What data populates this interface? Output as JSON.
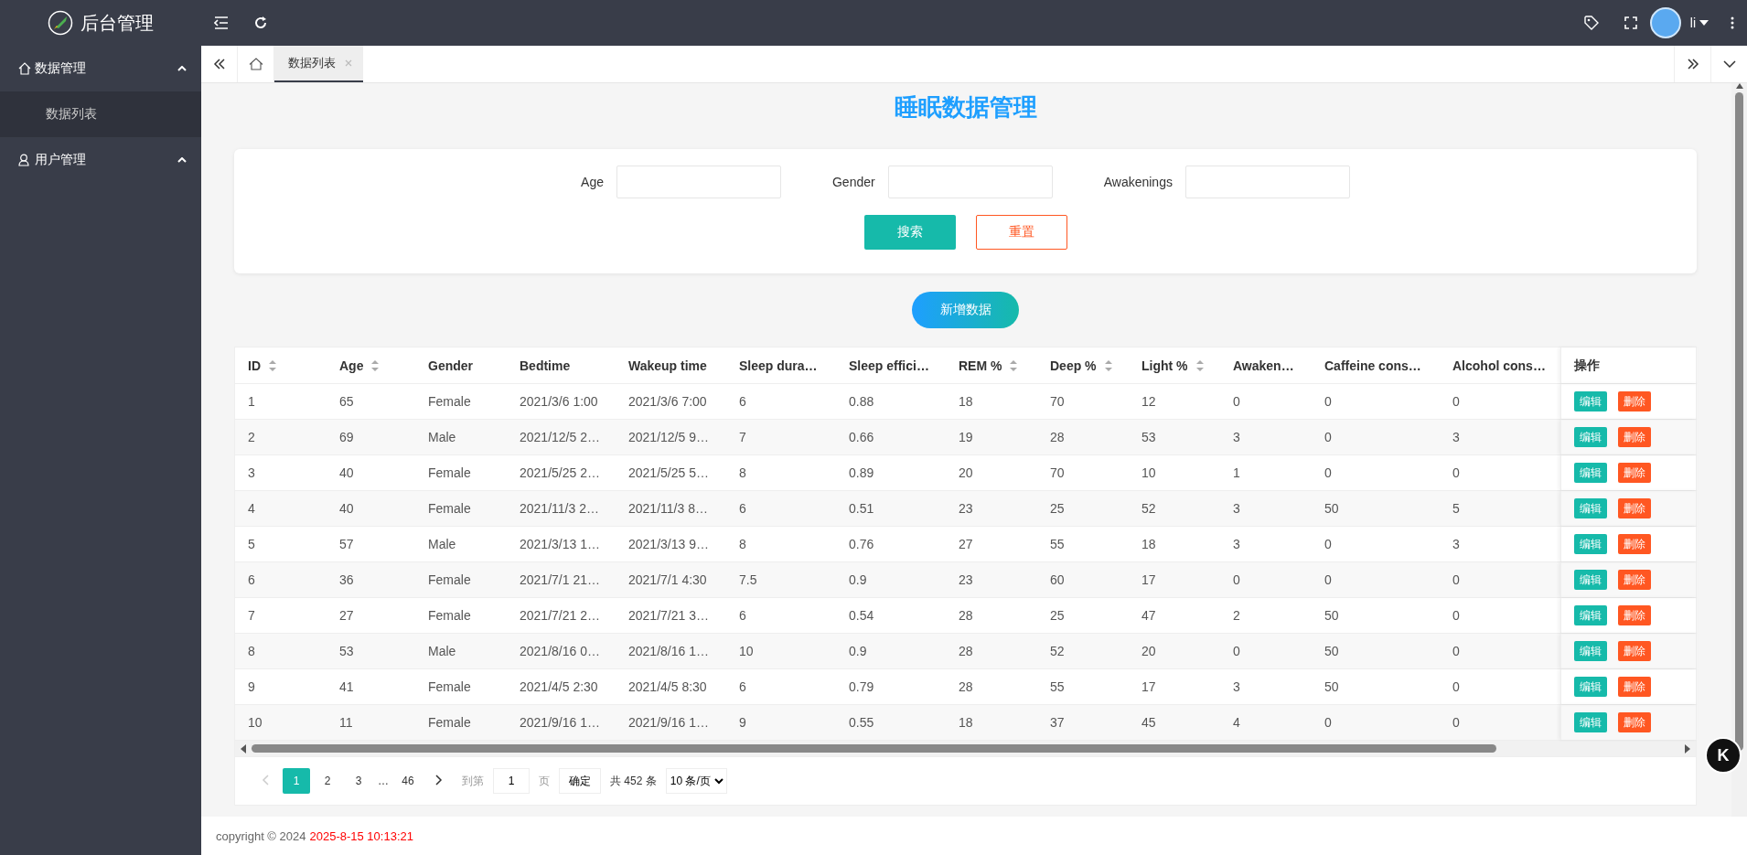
{
  "app": {
    "title": "后台管理"
  },
  "header": {
    "user": "li"
  },
  "sidebar": {
    "groups": [
      {
        "label": "数据管理",
        "kind": "data",
        "expanded": true,
        "children": [
          {
            "label": "数据列表",
            "selected": true
          }
        ]
      },
      {
        "label": "用户管理",
        "kind": "user",
        "expanded": true
      }
    ]
  },
  "tabs": [
    {
      "label": "数据列表",
      "selected": true
    }
  ],
  "page_title": "睡眠数据管理",
  "search": {
    "fields": [
      {
        "label": "Age"
      },
      {
        "label": "Gender"
      },
      {
        "label": "Awakenings"
      }
    ],
    "buttons": [
      {
        "label": "搜索",
        "kind": "primary"
      },
      {
        "label": "重置",
        "kind": "outline"
      }
    ]
  },
  "add_button": "新增数据",
  "table": {
    "columns": [
      {
        "label": "ID",
        "sortable": true
      },
      {
        "label": "Age",
        "sortable": true
      },
      {
        "label": "Gender",
        "sortable": false
      },
      {
        "label": "Bedtime",
        "sortable": false
      },
      {
        "label": "Wakeup time",
        "sortable": false
      },
      {
        "label": "Sleep dura…",
        "sortable": false
      },
      {
        "label": "Sleep effici…",
        "sortable": false
      },
      {
        "label": "REM %",
        "sortable": true
      },
      {
        "label": "Deep %",
        "sortable": true
      },
      {
        "label": "Light %",
        "sortable": true
      },
      {
        "label": "Awaken…",
        "sortable": false
      },
      {
        "label": "Caffeine cons…",
        "sortable": false
      },
      {
        "label": "Alcohol cons…",
        "sortable": false
      }
    ],
    "action_column": "操作",
    "rows": [
      {
        "cells": [
          "1",
          "65",
          "Female",
          "2021/3/6 1:00",
          "2021/3/6 7:00",
          "6",
          "0.88",
          "18",
          "70",
          "12",
          "0",
          "0",
          "0"
        ],
        "actions": [
          {
            "label": "编辑",
            "kind": "edit"
          },
          {
            "label": "删除",
            "kind": "delete"
          }
        ]
      },
      {
        "cells": [
          "2",
          "69",
          "Male",
          "2021/12/5 2…",
          "2021/12/5 9…",
          "7",
          "0.66",
          "19",
          "28",
          "53",
          "3",
          "0",
          "3"
        ],
        "actions": [
          {
            "label": "编辑",
            "kind": "edit"
          },
          {
            "label": "删除",
            "kind": "delete"
          }
        ]
      },
      {
        "cells": [
          "3",
          "40",
          "Female",
          "2021/5/25 2…",
          "2021/5/25 5…",
          "8",
          "0.89",
          "20",
          "70",
          "10",
          "1",
          "0",
          "0"
        ],
        "actions": [
          {
            "label": "编辑",
            "kind": "edit"
          },
          {
            "label": "删除",
            "kind": "delete"
          }
        ]
      },
      {
        "cells": [
          "4",
          "40",
          "Female",
          "2021/11/3 2…",
          "2021/11/3 8…",
          "6",
          "0.51",
          "23",
          "25",
          "52",
          "3",
          "50",
          "5"
        ],
        "actions": [
          {
            "label": "编辑",
            "kind": "edit"
          },
          {
            "label": "删除",
            "kind": "delete"
          }
        ]
      },
      {
        "cells": [
          "5",
          "57",
          "Male",
          "2021/3/13 1…",
          "2021/3/13 9…",
          "8",
          "0.76",
          "27",
          "55",
          "18",
          "3",
          "0",
          "3"
        ],
        "actions": [
          {
            "label": "编辑",
            "kind": "edit"
          },
          {
            "label": "删除",
            "kind": "delete"
          }
        ]
      },
      {
        "cells": [
          "6",
          "36",
          "Female",
          "2021/7/1 21…",
          "2021/7/1 4:30",
          "7.5",
          "0.9",
          "23",
          "60",
          "17",
          "0",
          "0",
          "0"
        ],
        "actions": [
          {
            "label": "编辑",
            "kind": "edit"
          },
          {
            "label": "删除",
            "kind": "delete"
          }
        ]
      },
      {
        "cells": [
          "7",
          "27",
          "Female",
          "2021/7/21 2…",
          "2021/7/21 3…",
          "6",
          "0.54",
          "28",
          "25",
          "47",
          "2",
          "50",
          "0"
        ],
        "actions": [
          {
            "label": "编辑",
            "kind": "edit"
          },
          {
            "label": "删除",
            "kind": "delete"
          }
        ]
      },
      {
        "cells": [
          "8",
          "53",
          "Male",
          "2021/8/16 0…",
          "2021/8/16 1…",
          "10",
          "0.9",
          "28",
          "52",
          "20",
          "0",
          "50",
          "0"
        ],
        "actions": [
          {
            "label": "编辑",
            "kind": "edit"
          },
          {
            "label": "删除",
            "kind": "delete"
          }
        ]
      },
      {
        "cells": [
          "9",
          "41",
          "Female",
          "2021/4/5 2:30",
          "2021/4/5 8:30",
          "6",
          "0.79",
          "28",
          "55",
          "17",
          "3",
          "50",
          "0"
        ],
        "actions": [
          {
            "label": "编辑",
            "kind": "edit"
          },
          {
            "label": "删除",
            "kind": "delete"
          }
        ]
      },
      {
        "cells": [
          "10",
          "11",
          "Female",
          "2021/9/16 1…",
          "2021/9/16 1…",
          "9",
          "0.55",
          "18",
          "37",
          "45",
          "4",
          "0",
          "0"
        ],
        "actions": [
          {
            "label": "编辑",
            "kind": "edit"
          },
          {
            "label": "删除",
            "kind": "delete"
          }
        ]
      }
    ]
  },
  "pagination": {
    "prev_disabled": true,
    "next_disabled": false,
    "pages": [
      {
        "label": "1",
        "kind": "page",
        "selected": true
      },
      {
        "label": "2",
        "kind": "page",
        "selected": false
      },
      {
        "label": "3",
        "kind": "page",
        "selected": false
      },
      {
        "label": "…",
        "kind": "ellipsis"
      },
      {
        "label": "46",
        "kind": "page",
        "selected": false
      }
    ],
    "goto_label": "到第",
    "goto_value": "1",
    "page_unit": "页",
    "confirm": "确定",
    "total": "共 452 条",
    "page_size": "10 条/页"
  },
  "footer": {
    "copyright": "copyright © 2024",
    "timestamp": "2025-8-15 10:13:21"
  },
  "floating_button": "K"
}
